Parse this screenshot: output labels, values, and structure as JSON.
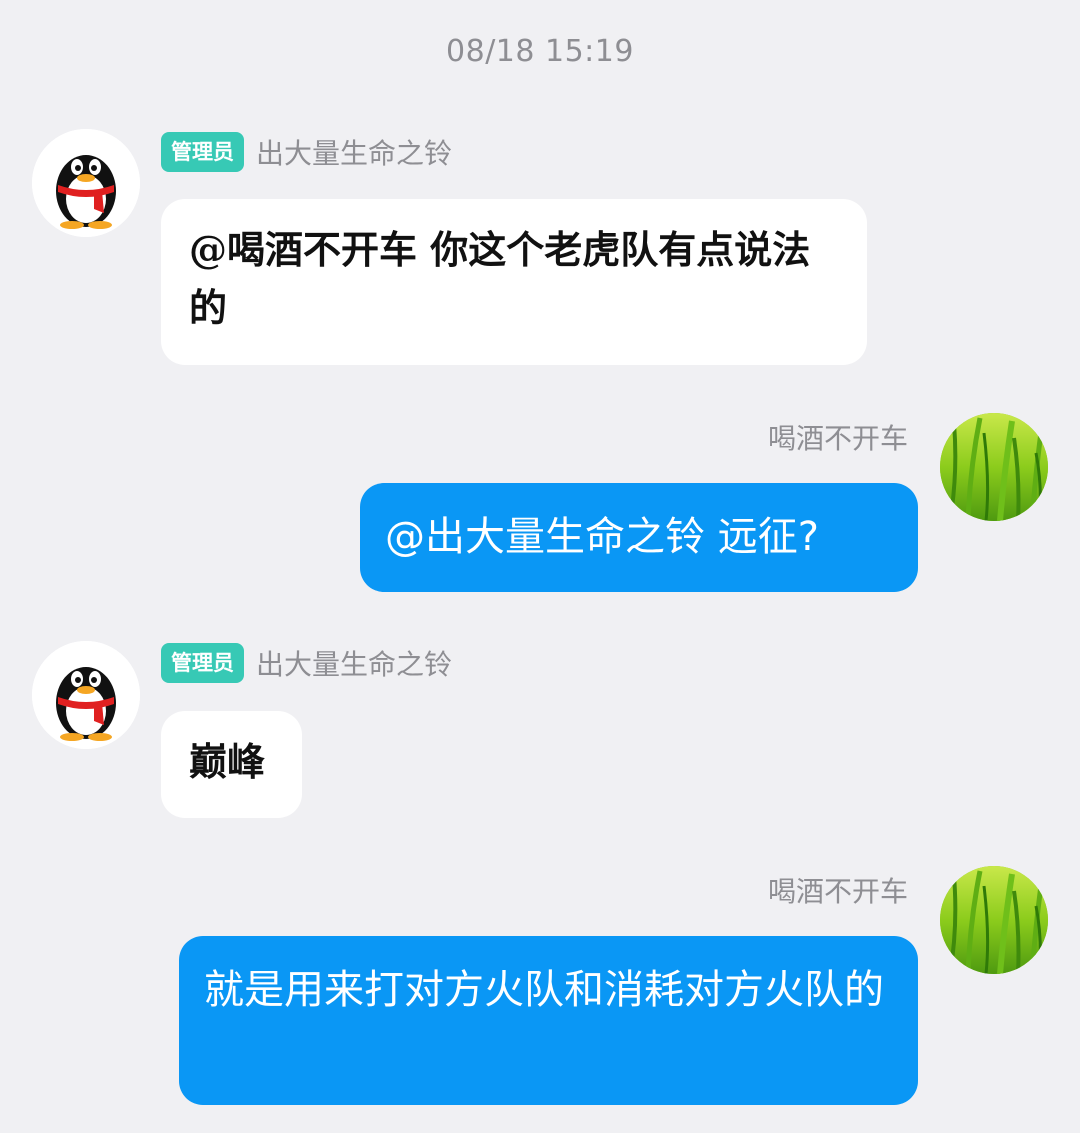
{
  "timestamp": "08/18 15:19",
  "colors": {
    "background": "#f0f0f3",
    "incoming_bubble": "#ffffff",
    "outgoing_bubble": "#0a97f5",
    "admin_badge": "#37c9b5",
    "meta_text": "#8e8e93"
  },
  "messages": [
    {
      "direction": "incoming",
      "badge": "管理员",
      "sender": "出大量生命之铃",
      "avatar": "qq-penguin-avatar",
      "text": "@喝酒不开车 你这个老虎队有点说法的"
    },
    {
      "direction": "outgoing",
      "sender": "喝酒不开车",
      "avatar": "grass-avatar",
      "text": "@出大量生命之铃 远征?"
    },
    {
      "direction": "incoming",
      "badge": "管理员",
      "sender": "出大量生命之铃",
      "avatar": "qq-penguin-avatar",
      "text": "巅峰"
    },
    {
      "direction": "outgoing",
      "sender": "喝酒不开车",
      "avatar": "grass-avatar",
      "text": "就是用来打对方火队和消耗对方火队的"
    }
  ]
}
